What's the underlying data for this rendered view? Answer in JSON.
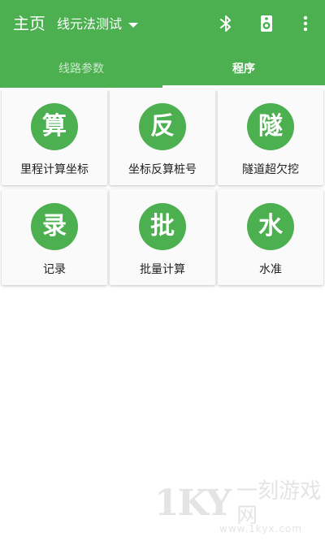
{
  "toolbar": {
    "title": "主页",
    "project": "线元法测试",
    "icons": [
      "bluetooth-icon",
      "speaker-icon",
      "more-vert-icon"
    ]
  },
  "tabs": [
    {
      "label": "线路参数",
      "active": false
    },
    {
      "label": "程序",
      "active": true
    }
  ],
  "cards": [
    {
      "glyph": "算",
      "label": "里程计算坐标"
    },
    {
      "glyph": "反",
      "label": "坐标反算桩号"
    },
    {
      "glyph": "隧",
      "label": "隧道超欠挖"
    },
    {
      "glyph": "录",
      "label": "记录"
    },
    {
      "glyph": "批",
      "label": "批量计算"
    },
    {
      "glyph": "水",
      "label": "水准"
    }
  ],
  "watermark": {
    "logo": "1KY",
    "name": "一刻游戏网",
    "url": "www.1kyx.com"
  },
  "colors": {
    "primary": "#4caf50",
    "on_primary": "#ffffff",
    "card_bg": "#fafafa"
  }
}
